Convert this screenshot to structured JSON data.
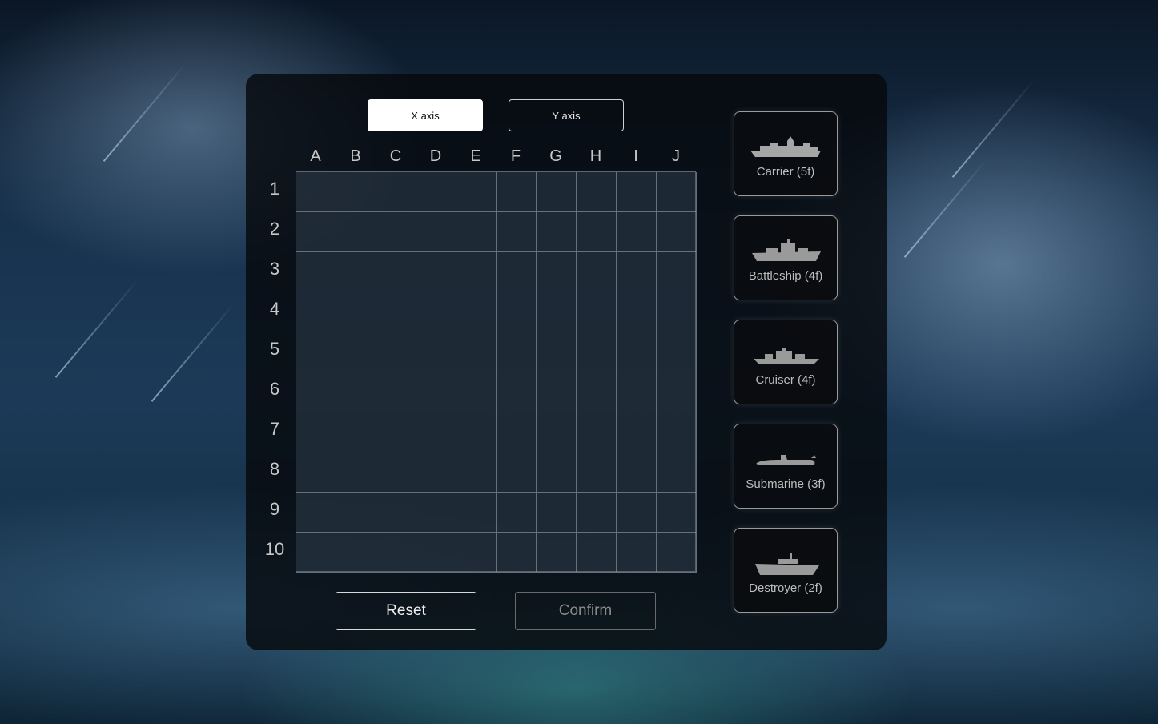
{
  "axis_buttons": {
    "x_label": "X axis",
    "y_label": "Y axis",
    "selected": "X axis"
  },
  "board": {
    "columns": [
      "A",
      "B",
      "C",
      "D",
      "E",
      "F",
      "G",
      "H",
      "I",
      "J"
    ],
    "rows": [
      "1",
      "2",
      "3",
      "4",
      "5",
      "6",
      "7",
      "8",
      "9",
      "10"
    ]
  },
  "actions": {
    "reset_label": "Reset",
    "confirm_label": "Confirm"
  },
  "ships": [
    {
      "label": "Carrier (5f)",
      "icon": "carrier-icon"
    },
    {
      "label": "Battleship (4f)",
      "icon": "battleship-icon"
    },
    {
      "label": "Cruiser (4f)",
      "icon": "cruiser-icon"
    },
    {
      "label": "Submarine (3f)",
      "icon": "submarine-icon"
    },
    {
      "label": "Destroyer (2f)",
      "icon": "destroyer-icon"
    }
  ],
  "colors": {
    "panel": "#06080c",
    "grid_line": "#96a0aa",
    "active_button": "#ffffff",
    "ship_silhouette": "#9a9a9a"
  }
}
